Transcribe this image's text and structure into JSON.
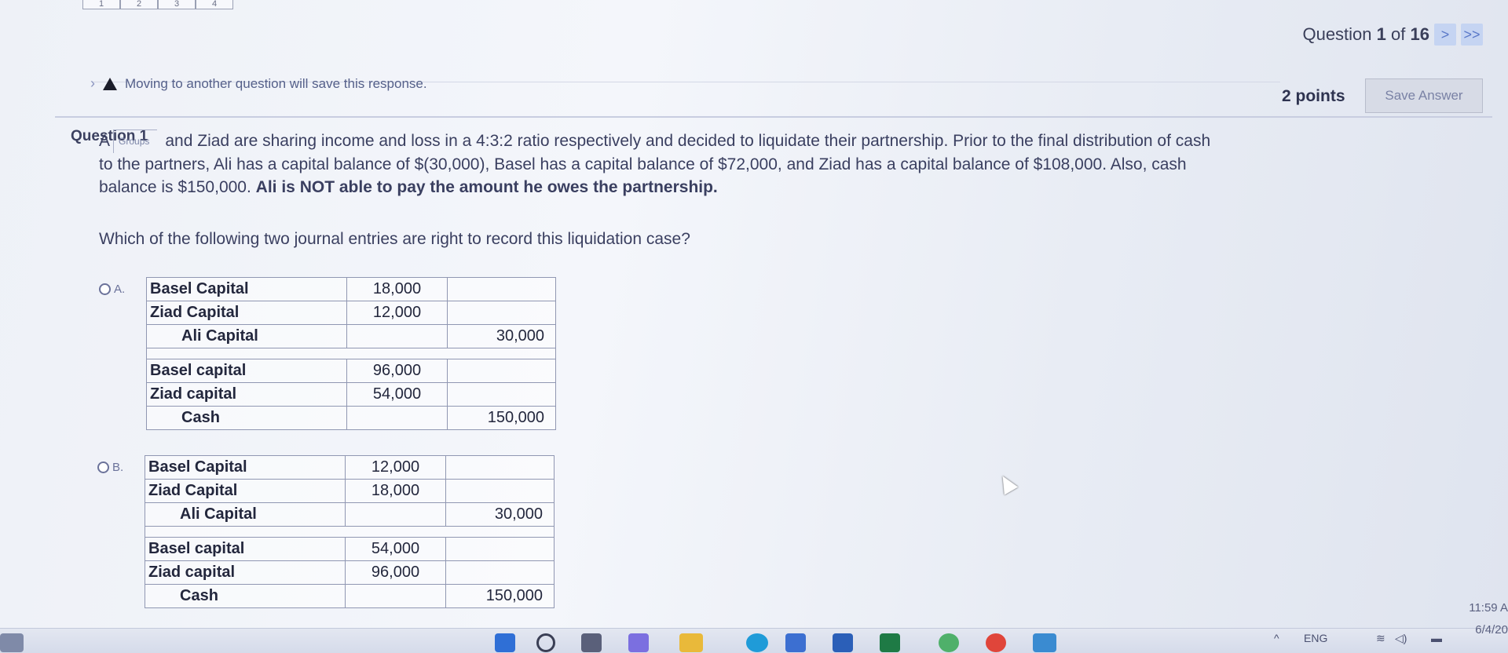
{
  "page_tabs": [
    "1",
    "2",
    "3",
    "4"
  ],
  "nav": {
    "question_label": "Question",
    "current": "1",
    "of_label": "of",
    "total": "16",
    "next_glyph": ">",
    "last_glyph": ">>"
  },
  "notice": {
    "text": "Moving to another question will save this response."
  },
  "header": {
    "points": "2 points",
    "save_label": "Save Answer"
  },
  "question": {
    "title": "Question 1",
    "groups_tag": "Groups",
    "line1_prefix": "A",
    "line1": "and Ziad are sharing income and loss in a 4:3:2 ratio respectively and decided to liquidate their partnership. Prior to the final distribution of cash",
    "line2": "to the partners, Ali has a capital balance of $(30,000), Basel has a capital balance of $72,000, and Ziad has a capital balance of $108,000. Also, cash",
    "line3_plain": "balance is $150,000.",
    "line3_bold": "Ali is NOT able to pay the amount he owes the partnership.",
    "prompt": "Which of the following two journal entries are right to record this liquidation case?"
  },
  "options": [
    {
      "letter": "A.",
      "entry1": [
        {
          "account": "Basel Capital",
          "debit": "18,000",
          "credit": ""
        },
        {
          "account": "Ziad Capital",
          "debit": "12,000",
          "credit": ""
        },
        {
          "account": "Ali Capital",
          "debit": "",
          "credit": "30,000"
        }
      ],
      "entry2": [
        {
          "account": "Basel capital",
          "debit": "96,000",
          "credit": ""
        },
        {
          "account": "Ziad capital",
          "debit": "54,000",
          "credit": ""
        },
        {
          "account": "Cash",
          "debit": "",
          "credit": "150,000"
        }
      ]
    },
    {
      "letter": "B.",
      "entry1": [
        {
          "account": "Basel Capital",
          "debit": "12,000",
          "credit": ""
        },
        {
          "account": "Ziad Capital",
          "debit": "18,000",
          "credit": ""
        },
        {
          "account": "Ali Capital",
          "debit": "",
          "credit": "30,000"
        }
      ],
      "entry2": [
        {
          "account": "Basel capital",
          "debit": "54,000",
          "credit": ""
        },
        {
          "account": "Ziad capital",
          "debit": "96,000",
          "credit": ""
        },
        {
          "account": "Cash",
          "debit": "",
          "credit": "150,000"
        }
      ]
    }
  ],
  "taskbar": {
    "language": "ENG",
    "time": "11:59 A",
    "date": "6/4/20"
  }
}
